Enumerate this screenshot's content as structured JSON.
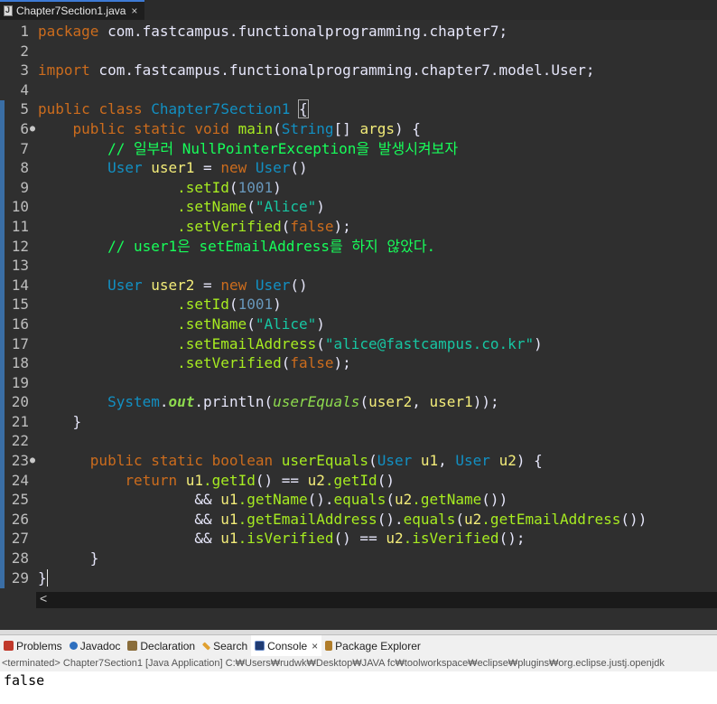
{
  "editor_tab": {
    "filename": "Chapter7Section1.java",
    "close": "×"
  },
  "code": {
    "l1": {
      "n": "1",
      "kw": "package",
      "rest": " com.fastcampus.functionalprogramming.chapter7;"
    },
    "l2": {
      "n": "2"
    },
    "l3": {
      "n": "3",
      "kw": "import",
      "rest": " com.fastcampus.functionalprogramming.chapter7.model.User;"
    },
    "l4": {
      "n": "4"
    },
    "l5": {
      "n": "5",
      "kw1": "public",
      "kw2": "class",
      "cls": "Chapter7Section1",
      "brace": "{"
    },
    "l6": {
      "n": "6",
      "kw": "public static void",
      "fn": "main",
      "p1": "(",
      "cls": "String",
      "p2": "[] ",
      "var": "args",
      "p3": ") {"
    },
    "l7": {
      "n": "7",
      "cmt": "// 일부러 NullPointerException을 발생시켜보자"
    },
    "l8": {
      "n": "8",
      "cls": "User",
      "var": "user1",
      "eq": " = ",
      "kw": "new",
      "cls2": "User",
      "p": "()"
    },
    "l9": {
      "n": "9",
      "fn": ".setId",
      "p1": "(",
      "num": "1001",
      "p2": ")"
    },
    "l10": {
      "n": "10",
      "fn": ".setName",
      "p1": "(",
      "str": "\"Alice\"",
      "p2": ")"
    },
    "l11": {
      "n": "11",
      "fn": ".setVerified",
      "p1": "(",
      "kw": "false",
      "p2": ");"
    },
    "l12": {
      "n": "12",
      "cmt": "// user1은 setEmailAddress를 하지 않았다."
    },
    "l13": {
      "n": "13"
    },
    "l14": {
      "n": "14",
      "cls": "User",
      "var": "user2",
      "eq": " = ",
      "kw": "new",
      "cls2": "User",
      "p": "()"
    },
    "l15": {
      "n": "15",
      "fn": ".setId",
      "p1": "(",
      "num": "1001",
      "p2": ")"
    },
    "l16": {
      "n": "16",
      "fn": ".setName",
      "p1": "(",
      "str": "\"Alice\"",
      "p2": ")"
    },
    "l17": {
      "n": "17",
      "fn": ".setEmailAddress",
      "p1": "(",
      "str": "\"alice@fastcampus.co.kr\"",
      "p2": ")"
    },
    "l18": {
      "n": "18",
      "fn": ".setVerified",
      "p1": "(",
      "kw": "false",
      "p2": ");"
    },
    "l19": {
      "n": "19"
    },
    "l20": {
      "n": "20",
      "cls": "System",
      "dot": ".",
      "out": "out",
      "fn": ".println",
      "p1": "(",
      "sfn": "userEquals",
      "p2": "(",
      "v1": "user2",
      "c": ", ",
      "v2": "user1",
      "p3": "));"
    },
    "l21": {
      "n": "21",
      "p": "}"
    },
    "l22": {
      "n": "22"
    },
    "l23": {
      "n": "23",
      "kw": "public static boolean",
      "fn": "userEquals",
      "p1": "(",
      "c1": "User",
      "v1": "u1",
      "c": ", ",
      "c2": "User",
      "v2": "u2",
      "p2": ") {"
    },
    "l24": {
      "n": "24",
      "kw": "return",
      "v1": "u1",
      "f1": ".getId",
      "p1": "() == ",
      "v2": "u2",
      "f2": ".getId",
      "p2": "()"
    },
    "l25": {
      "n": "25",
      "amp": "&& ",
      "v1": "u1",
      "f1": ".getName",
      "p1": "().",
      "f2": "equals",
      "p2": "(",
      "v2": "u2",
      "f3": ".getName",
      "p3": "())"
    },
    "l26": {
      "n": "26",
      "amp": "&& ",
      "v1": "u1",
      "f1": ".getEmailAddress",
      "p1": "().",
      "f2": "equals",
      "p2": "(",
      "v2": "u2",
      "f3": ".getEmailAddress",
      "p3": "())"
    },
    "l27": {
      "n": "27",
      "amp": "&& ",
      "v1": "u1",
      "f1": ".isVerified",
      "p1": "() == ",
      "v2": "u2",
      "f2": ".isVerified",
      "p2": "();"
    },
    "l28": {
      "n": "28",
      "p": "}"
    },
    "l29": {
      "n": "29",
      "p": "}"
    }
  },
  "scroll": {
    "left_arrow": "<"
  },
  "views": {
    "problems": "Problems",
    "javadoc": "Javadoc",
    "declaration": "Declaration",
    "search": "Search",
    "console": "Console",
    "console_close": "×",
    "package_explorer": "Package Explorer"
  },
  "console": {
    "header": "<terminated> Chapter7Section1 [Java Application] C:₩Users₩rudwk₩Desktop₩JAVA fc₩toolworkspace₩eclipse₩plugins₩org.eclipse.justj.openjdk",
    "output": "false"
  },
  "colors": {
    "background": "#2f2f2f",
    "ruler": "#3a6ea5",
    "keyword": "#cc6c1d",
    "class": "#1290c3",
    "method": "#a7ec21",
    "string": "#17c6a3",
    "comment": "#17ff5a"
  }
}
